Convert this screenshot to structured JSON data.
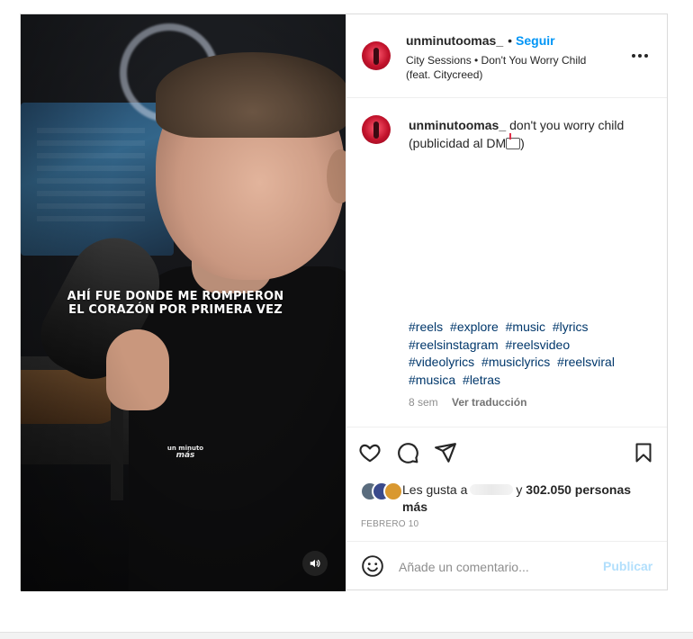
{
  "media": {
    "lyric_line_1": "AHÍ FUE DONDE ME ROMPIERON",
    "lyric_line_2": "EL CORAZÓN POR PRIMERA VEZ",
    "watermark_small": "un minuto",
    "watermark_big": "más",
    "mute_icon": "speaker-icon"
  },
  "header": {
    "username": "unminutoomas_",
    "separator": "•",
    "follow_label": "Seguir",
    "audio_line": "City Sessions • Don't You Worry Child (feat. Citycreed)",
    "more_icon": "more-horizontal-icon"
  },
  "caption": {
    "username": "unminutoomas_",
    "text_before_icon": "don't you worry child (publicidad al DM",
    "text_after_icon": ")",
    "icon": "mailbox-icon"
  },
  "hashtags": [
    "#reels",
    "#explore",
    "#music",
    "#lyrics",
    "#reelsinstagram",
    "#reelsvideo",
    "#videolyrics",
    "#musiclyrics",
    "#reelsviral",
    "#musica",
    "#letras"
  ],
  "meta": {
    "age": "8 sem",
    "translate": "Ver traducción"
  },
  "actions": {
    "like_icon": "heart-icon",
    "comment_icon": "comment-icon",
    "share_icon": "send-icon",
    "save_icon": "bookmark-icon"
  },
  "likes": {
    "prefix": "Les gusta a",
    "connector": "y",
    "count": "302.050 personas",
    "suffix": "más"
  },
  "date": "FEBRERO 10",
  "comment": {
    "placeholder": "Añade un comentario...",
    "publish_label": "Publicar",
    "emoji_icon": "emoji-smile-icon"
  },
  "colors": {
    "follow_blue": "#0095f6",
    "hashtag_blue": "#00376b",
    "publish_disabled": "#b2dffc",
    "muted_text": "#8e8e8e"
  }
}
